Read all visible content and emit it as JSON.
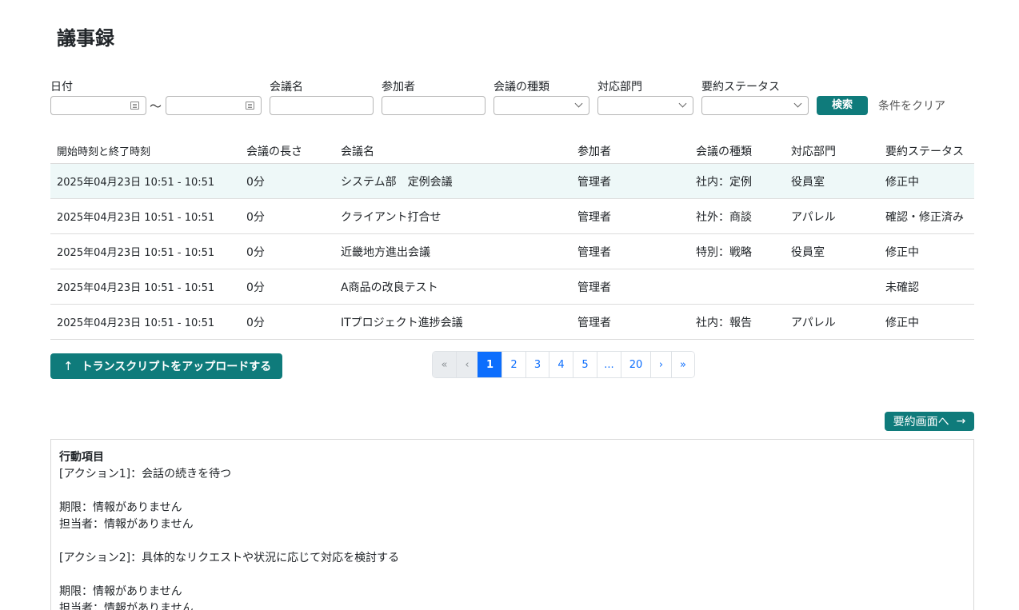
{
  "page": {
    "title": "議事録"
  },
  "filters": {
    "date_label": "日付",
    "tilde": "〜",
    "meeting_name_label": "会議名",
    "participant_label": "参加者",
    "meeting_type_label": "会議の種類",
    "department_label": "対応部門",
    "summary_status_label": "要約ステータス",
    "search_button": "検索",
    "clear_button": "条件をクリア"
  },
  "table": {
    "headers": [
      "開始時刻と終了時刻",
      "会議の長さ",
      "会議名",
      "参加者",
      "会議の種類",
      "対応部門",
      "要約ステータス"
    ],
    "rows": [
      [
        "2025年04月23日 10:51 - 10:51",
        "0分",
        "システム部　定例会議",
        "管理者",
        "社内：定例",
        "役員室",
        "修正中"
      ],
      [
        "2025年04月23日 10:51 - 10:51",
        "0分",
        "クライアント打合せ",
        "管理者",
        "社外：商談",
        "アパレル",
        "確認・修正済み"
      ],
      [
        "2025年04月23日 10:51 - 10:51",
        "0分",
        "近畿地方進出会議",
        "管理者",
        "特別：戦略",
        "役員室",
        "修正中"
      ],
      [
        "2025年04月23日 10:51 - 10:51",
        "0分",
        "A商品の改良テスト",
        "管理者",
        "",
        "",
        "未確認"
      ],
      [
        "2025年04月23日 10:51 - 10:51",
        "0分",
        "ITプロジェクト進捗会議",
        "管理者",
        "社内：報告",
        "アパレル",
        "修正中"
      ]
    ]
  },
  "upload": {
    "arrow": "↑",
    "label": "トランスクリプトをアップロードする"
  },
  "pagination": {
    "items": [
      "«",
      "‹",
      "1",
      "2",
      "3",
      "4",
      "5",
      "...",
      "20",
      "›",
      "»"
    ],
    "active": "1"
  },
  "summary_button": {
    "label": "要約画面へ",
    "arrow": "→"
  },
  "summary": {
    "heading": "行動項目",
    "lines": [
      "[アクション1]：会話の続きを待つ",
      "",
      "期限：情報がありません",
      "担当者：情報がありません",
      "",
      "[アクション2]：具体的なリクエストや状況に応じて対応を検討する",
      "",
      "期限：情報がありません",
      "担当者：情報がありません"
    ]
  }
}
